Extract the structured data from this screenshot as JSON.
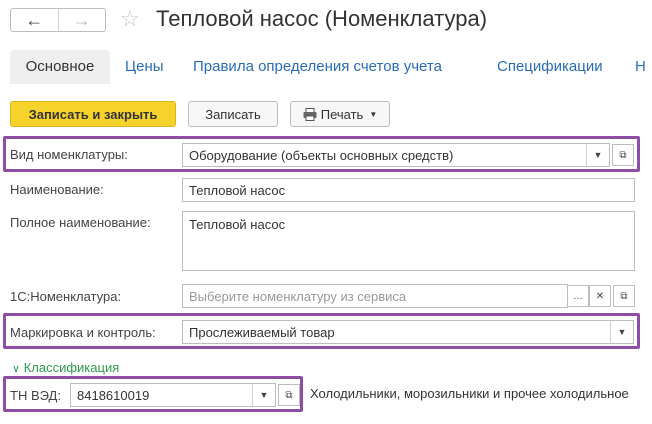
{
  "window": {
    "title": "Тепловой насос (Номенклатура)"
  },
  "nav": {
    "back_icon": "←",
    "forward_icon": "→",
    "star_icon": "☆"
  },
  "tabs": [
    {
      "label": "Основное"
    },
    {
      "label": "Цены"
    },
    {
      "label": "Правила определения счетов учета"
    },
    {
      "label": "Спецификации"
    },
    {
      "label": "Н"
    }
  ],
  "toolbar": {
    "write_close": "Записать и закрыть",
    "write": "Записать",
    "print": "Печать"
  },
  "form": {
    "kind": {
      "label": "Вид номенклатуры:",
      "value": "Оборудование (объекты основных средств)"
    },
    "name": {
      "label": "Наименование:",
      "value": "Тепловой насос"
    },
    "full_name": {
      "label": "Полное наименование:",
      "value": "Тепловой насос"
    },
    "nomenclature_1c": {
      "label": "1С:Номенклатура:",
      "placeholder": "Выберите номенклатуру из сервиса"
    },
    "marking": {
      "label": "Маркировка и контроль:",
      "value": "Прослеживаемый товар"
    },
    "section": {
      "label": "Классификация"
    },
    "tnved": {
      "label": "ТН ВЭД:",
      "value": "8418610019",
      "description": "Холодильники, морозильники и прочее холодильное"
    }
  },
  "highlight_color": "#8e4ea6"
}
